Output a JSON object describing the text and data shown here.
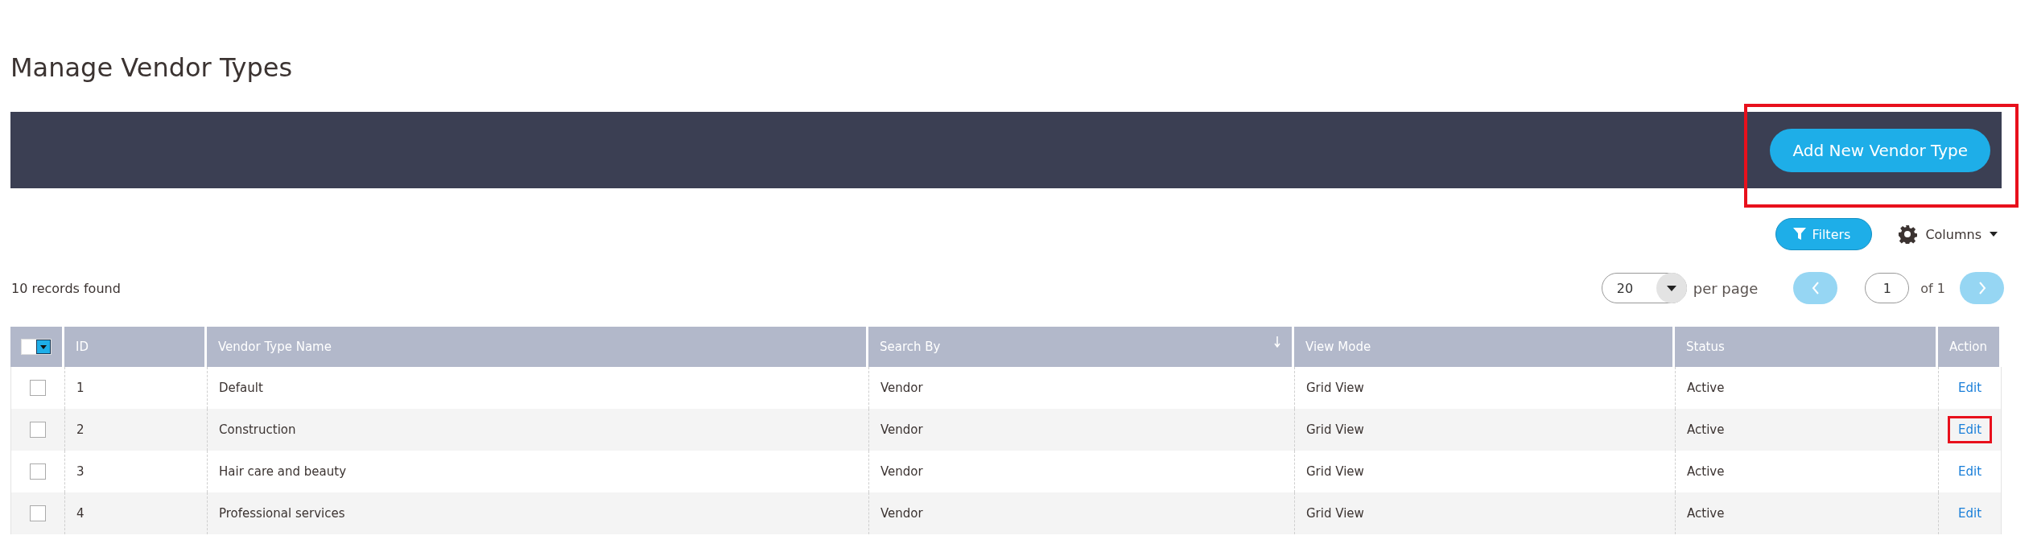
{
  "page": {
    "title": "Manage Vendor Types"
  },
  "action_bar": {
    "add_button": {
      "label": "Add New Vendor Type",
      "highlighted": true
    }
  },
  "toolbar": {
    "filters_button": "Filters",
    "columns_menu": "Columns"
  },
  "records_count": "10 records found",
  "pagination": {
    "per_page": "20",
    "per_page_label": "per page",
    "page": "1",
    "of_pages": "of 1"
  },
  "table": {
    "select_all": {
      "checked": false
    },
    "columns": [
      {
        "label": "ID",
        "sorted": false
      },
      {
        "label": "Vendor Type Name",
        "sorted": false
      },
      {
        "label": "Search By",
        "sorted": true
      },
      {
        "label": "View Mode",
        "sorted": false
      },
      {
        "label": "Status",
        "sorted": false
      },
      {
        "label": "Action",
        "sorted": false
      }
    ],
    "rows": [
      {
        "checked": false,
        "cells": [
          "1",
          "Default",
          "Vendor",
          "Grid View",
          "Active"
        ],
        "action": "Edit",
        "highlighted": false
      },
      {
        "checked": false,
        "cells": [
          "2",
          "Construction",
          "Vendor",
          "Grid View",
          "Active"
        ],
        "action": "Edit",
        "highlighted": true
      },
      {
        "checked": false,
        "cells": [
          "3",
          "Hair care and beauty",
          "Vendor",
          "Grid View",
          "Active"
        ],
        "action": "Edit",
        "highlighted": false
      },
      {
        "checked": false,
        "cells": [
          "4",
          "Professional services",
          "Vendor",
          "Grid View",
          "Active"
        ],
        "action": "Edit",
        "highlighted": false
      }
    ]
  }
}
